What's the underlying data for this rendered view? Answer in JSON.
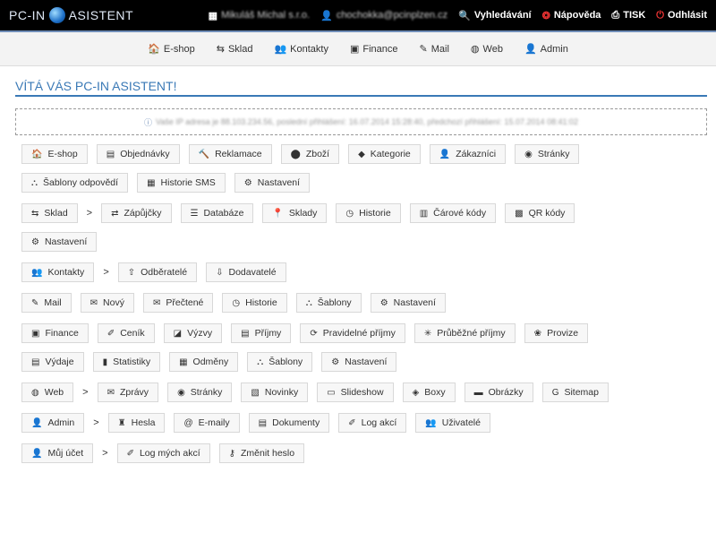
{
  "top": {
    "logo_left": "PC-IN",
    "logo_right": "ASISTENT",
    "company": "Mikuláš Michal s.r.o.",
    "user": "chochokka@pcinplzen.cz",
    "search": "Vyhledávání",
    "help": "Nápověda",
    "print": "TISK",
    "logout": "Odhlásit"
  },
  "nav": [
    "E-shop",
    "Sklad",
    "Kontakty",
    "Finance",
    "Mail",
    "Web",
    "Admin"
  ],
  "welcome": "VÍTÁ VÁS PC-IN ASISTENT!",
  "info": "Vaše IP adresa je 88.103.234.56, poslední přihlášení: 16.07.2014 15:28:40, předchozí přihlášení: 15.07.2014 08:41:02",
  "sections": [
    {
      "rows": [
        [
          "E-shop",
          "Objednávky",
          "Reklamace",
          "Zboží",
          "Kategorie",
          "Zákazníci",
          "Stránky"
        ],
        [
          "Šablony odpovědí",
          "Historie SMS",
          "Nastavení"
        ]
      ],
      "hub": false
    },
    {
      "rows": [
        [
          "Sklad",
          ">",
          "Zápůjčky",
          "Databáze",
          "Sklady",
          "Historie",
          "Čárové kódy",
          "QR kódy"
        ],
        [
          "Nastavení"
        ]
      ],
      "hub": true
    },
    {
      "rows": [
        [
          "Kontakty",
          ">",
          "Odběratelé",
          "Dodavatelé"
        ]
      ],
      "hub": true
    },
    {
      "rows": [
        [
          "Mail",
          "Nový",
          "Přečtené",
          "Historie",
          "Šablony",
          "Nastavení"
        ]
      ],
      "hub": false
    },
    {
      "rows": [
        [
          "Finance",
          "Ceník",
          "Výzvy",
          "Příjmy",
          "Pravidelné příjmy",
          "Průběžné příjmy",
          "Provize"
        ],
        [
          "Výdaje",
          "Statistiky",
          "Odměny",
          "Šablony",
          "Nastavení"
        ]
      ],
      "hub": false
    },
    {
      "rows": [
        [
          "Web",
          ">",
          "Zprávy",
          "Stránky",
          "Novinky",
          "Slideshow",
          "Boxy",
          "Obrázky",
          "Sitemap"
        ]
      ],
      "hub": true
    },
    {
      "rows": [
        [
          "Admin",
          ">",
          "Hesla",
          "E-maily",
          "Dokumenty",
          "Log akcí",
          "Uživatelé"
        ]
      ],
      "hub": true
    },
    {
      "rows": [
        [
          "Můj účet",
          ">",
          "Log mých akcí",
          "Změnit heslo"
        ]
      ],
      "hub": true
    }
  ],
  "icons": {
    "E-shop": "🏠",
    "Objednávky": "▤",
    "Reklamace": "🔨",
    "Zboží": "⬤",
    "Kategorie": "◆",
    "Zákazníci": "👤",
    "Stránky": "◉",
    "Šablony odpovědí": "⛬",
    "Historie SMS": "▦",
    "Nastavení": "⚙",
    "Sklad": "⇆",
    "Zápůjčky": "⇄",
    "Databáze": "☰",
    "Sklady": "📍",
    "Historie": "◷",
    "Čárové kódy": "▥",
    "QR kódy": "▩",
    "Kontakty": "👥",
    "Odběratelé": "⇧",
    "Dodavatelé": "⇩",
    "Mail": "✎",
    "Nový": "✉",
    "Přečtené": "✉",
    "Šablony": "⛬",
    "Finance": "▣",
    "Ceník": "✐",
    "Výzvy": "◪",
    "Příjmy": "▤",
    "Pravidelné příjmy": "⟳",
    "Průběžné příjmy": "✳",
    "Provize": "❀",
    "Výdaje": "▤",
    "Statistiky": "▮",
    "Odměny": "▦",
    "Web": "◍",
    "Zprávy": "✉",
    "Novinky": "▧",
    "Slideshow": "▭",
    "Boxy": "◈",
    "Obrázky": "▬",
    "Sitemap": "G",
    "Admin": "👤",
    "Hesla": "♜",
    "E-maily": "@",
    "Dokumenty": "▤",
    "Log akcí": "✐",
    "Uživatelé": "👥",
    "Můj účet": "👤",
    "Log mých akcí": "✐",
    "Změnit heslo": "⚷"
  },
  "colors": {
    "accent": "#3a79b6",
    "topbar": "#000000"
  }
}
